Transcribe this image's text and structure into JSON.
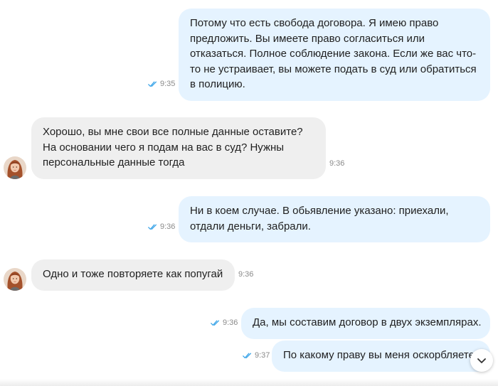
{
  "messages": [
    {
      "direction": "out",
      "text": "Потому что есть свобода договора. Я имею право предложить. Вы имеете право согласиться или отказаться. Полное соблюдение закона. Если же вас что-то не устраивает, вы можете подать в суд или обратиться в полицию.",
      "time": "9:35",
      "read": true
    },
    {
      "direction": "in",
      "text": "Хорошо, вы мне свои все полные данные оставите? На основании чего я подам на вас в суд? Нужны персональные данные тогда",
      "time": "9:36"
    },
    {
      "direction": "out",
      "text": "Ни в коем случае. В обьявление указано: приехали, отдали деньги, забрали.",
      "time": "9:36",
      "read": true
    },
    {
      "direction": "in",
      "text": "Одно и тоже повторяете как попугай",
      "time": "9:36"
    },
    {
      "direction": "out",
      "text": "Да, мы составим договор в двух экземплярах.",
      "time": "9:36",
      "read": true
    },
    {
      "direction": "out",
      "text": "По какому праву вы меня оскорбляете",
      "time": "9:37",
      "read": true
    }
  ],
  "colors": {
    "outgoing_bubble": "#e5f3ff",
    "incoming_bubble": "#efefef",
    "read_ticks": "#3aa4e8",
    "timestamp": "#8a8a8a"
  },
  "icons": {
    "read_status": "double-check-icon",
    "scroll_down": "chevron-down-icon",
    "contact_avatar": "avatar"
  }
}
